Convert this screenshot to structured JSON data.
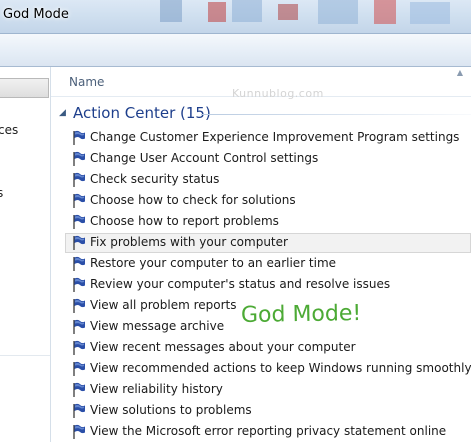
{
  "window": {
    "title": "God Mode"
  },
  "nav": {
    "items": [
      {
        "label": "ces"
      },
      {
        "label": "s"
      }
    ]
  },
  "content": {
    "column_header": "Name",
    "watermark": "Kunnublog.com",
    "overlay_text": "God Mode!",
    "group": {
      "title": "Action Center (15)",
      "items": [
        {
          "label": "Change Customer Experience Improvement Program settings"
        },
        {
          "label": "Change User Account Control settings"
        },
        {
          "label": "Check security status"
        },
        {
          "label": "Choose how to check for solutions"
        },
        {
          "label": "Choose how to report problems"
        },
        {
          "label": "Fix problems with your computer",
          "selected": true
        },
        {
          "label": "Restore your computer to an earlier time"
        },
        {
          "label": "Review your computer's status and resolve issues"
        },
        {
          "label": "View all problem reports"
        },
        {
          "label": "View message archive"
        },
        {
          "label": "View recent messages about your computer"
        },
        {
          "label": "View recommended actions to keep Windows running smoothly"
        },
        {
          "label": "View reliability history"
        },
        {
          "label": "View solutions to problems"
        },
        {
          "label": "View the Microsoft error reporting privacy statement online"
        }
      ]
    }
  },
  "colors": {
    "group_title": "#1e3f8c",
    "overlay_text": "#4caa35",
    "flag": "#2b4fa8"
  }
}
